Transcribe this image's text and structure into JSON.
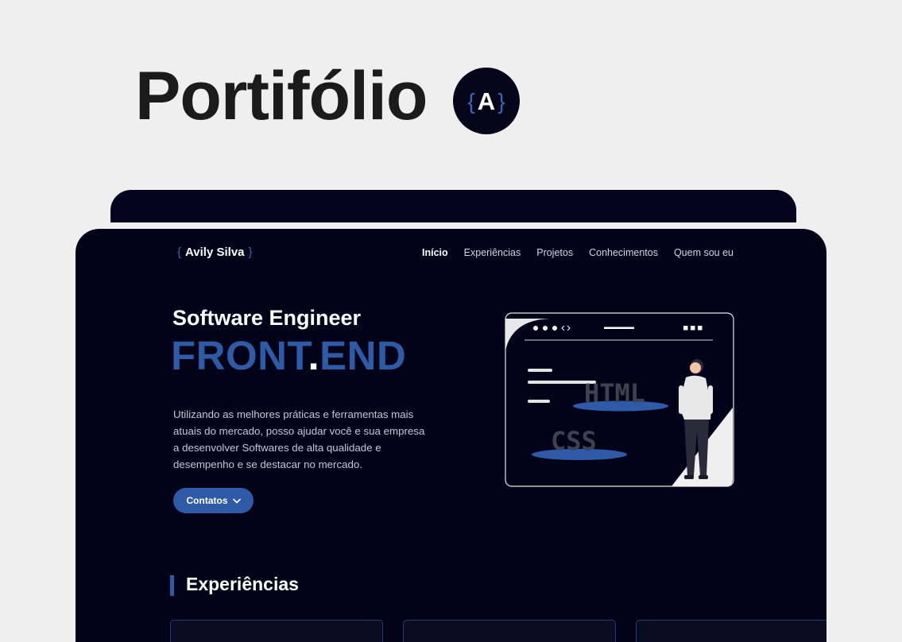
{
  "title": "Portifólio",
  "logo": {
    "letter": "A",
    "open_brace": "{",
    "close_brace": "}"
  },
  "site": {
    "brand": {
      "open": "{",
      "name": "Avily Silva",
      "close": "}"
    },
    "nav": [
      {
        "label": "Início",
        "active": true
      },
      {
        "label": "Experiências",
        "active": false
      },
      {
        "label": "Projetos",
        "active": false
      },
      {
        "label": "Conhecimentos",
        "active": false
      },
      {
        "label": "Quem sou eu",
        "active": false
      }
    ],
    "hero": {
      "role": "Software Engineer",
      "headline_part1": "FRONT",
      "headline_dot": ".",
      "headline_part2": "END",
      "description": "Utilizando as melhores práticas e ferramentas mais atuais do mercado, posso ajudar você e sua empresa a desenvolver Softwares de alta qualidade e desempenho e se destacar no mercado.",
      "cta_label": "Contatos",
      "cta_icon": "chevron-down-icon"
    },
    "illustration": {
      "label_html": "HTML",
      "label_css": "CSS"
    },
    "experiences": {
      "title": "Experiências"
    }
  },
  "colors": {
    "background": "#efefef",
    "dark": "#020219",
    "accent": "#2e5ba6",
    "text_light": "#c6c8d6"
  }
}
